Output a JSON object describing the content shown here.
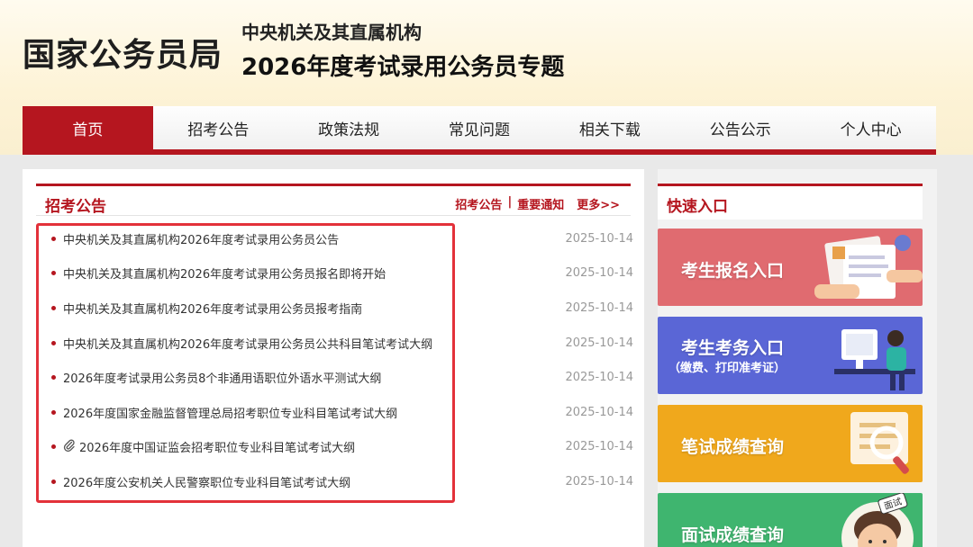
{
  "header": {
    "logo": "国家公务员局",
    "subtitle_line1": "中央机关及其直属机构",
    "subtitle_line2": "2026年度考试录用公务员专题"
  },
  "nav": {
    "items": [
      {
        "label": "首页"
      },
      {
        "label": "招考公告"
      },
      {
        "label": "政策法规"
      },
      {
        "label": "常见问题"
      },
      {
        "label": "相关下载"
      },
      {
        "label": "公告公示"
      },
      {
        "label": "个人中心"
      }
    ],
    "active_index": 0
  },
  "announcements": {
    "title": "招考公告",
    "link_announce": "招考公告",
    "separator": "|",
    "link_notice": "重要通知",
    "more": "更多>>",
    "items": [
      {
        "title": "中央机关及其直属机构2026年度考试录用公务员公告",
        "date": "2025-10-14"
      },
      {
        "title": "中央机关及其直属机构2026年度考试录用公务员报名即将开始",
        "date": "2025-10-14"
      },
      {
        "title": "中央机关及其直属机构2026年度考试录用公务员报考指南",
        "date": "2025-10-14"
      },
      {
        "title": "中央机关及其直属机构2026年度考试录用公务员公共科目笔试考试大纲",
        "date": "2025-10-14"
      },
      {
        "title": "2026年度考试录用公务员8个非通用语职位外语水平测试大纲",
        "date": "2025-10-14"
      },
      {
        "title": "2026年度国家金融监督管理总局招考职位专业科目笔试考试大纲",
        "date": "2025-10-14"
      },
      {
        "title": "2026年度中国证监会招考职位专业科目笔试考试大纲",
        "date": "2025-10-14",
        "icon": "paperclip-icon"
      },
      {
        "title": "2026年度公安机关人民警察职位专业科目笔试考试大纲",
        "date": "2025-10-14"
      }
    ]
  },
  "quick_entry": {
    "title": "快速入口",
    "entries": [
      {
        "label": "考生报名入口",
        "color": "#e06b70"
      },
      {
        "label": "考生考务入口",
        "sublabel": "（缴费、打印准考证）",
        "color": "#5a66d6"
      },
      {
        "label": "笔试成绩查询",
        "color": "#f0a81c"
      },
      {
        "label": "面试成绩查询",
        "color": "#3fb56f",
        "badge": "面试"
      }
    ]
  },
  "colors": {
    "brand_red": "#b5161f",
    "highlight_red": "#e3313a"
  }
}
